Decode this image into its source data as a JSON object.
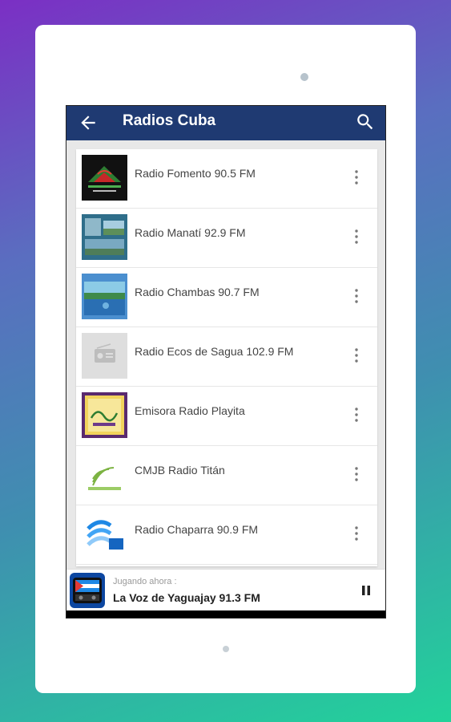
{
  "appbar": {
    "title": "Radios Cuba",
    "back_icon": "arrow-back-icon",
    "search_icon": "search-icon"
  },
  "stations": [
    {
      "name": "Radio Fomento 90.5 FM",
      "thumb": "fomento"
    },
    {
      "name": "Radio Manatí 92.9 FM",
      "thumb": "manati"
    },
    {
      "name": "Radio Chambas 90.7 FM",
      "thumb": "chambas"
    },
    {
      "name": "Radio Ecos de Sagua 102.9 FM",
      "thumb": "radio-placeholder"
    },
    {
      "name": "Emisora Radio Playita",
      "thumb": "playita"
    },
    {
      "name": "CMJB Radio Titán",
      "thumb": "titan"
    },
    {
      "name": "Radio Chaparra 90.9 FM",
      "thumb": "chaparra"
    }
  ],
  "player": {
    "caption": "Jugando ahora :",
    "station": "La Voz de Yaguajay 91.3 FM",
    "pause_icon": "pause-icon"
  },
  "colors": {
    "appbar": "#1f3a72",
    "background_gradient_start": "#7b2fc4",
    "background_gradient_end": "#22d39a"
  }
}
